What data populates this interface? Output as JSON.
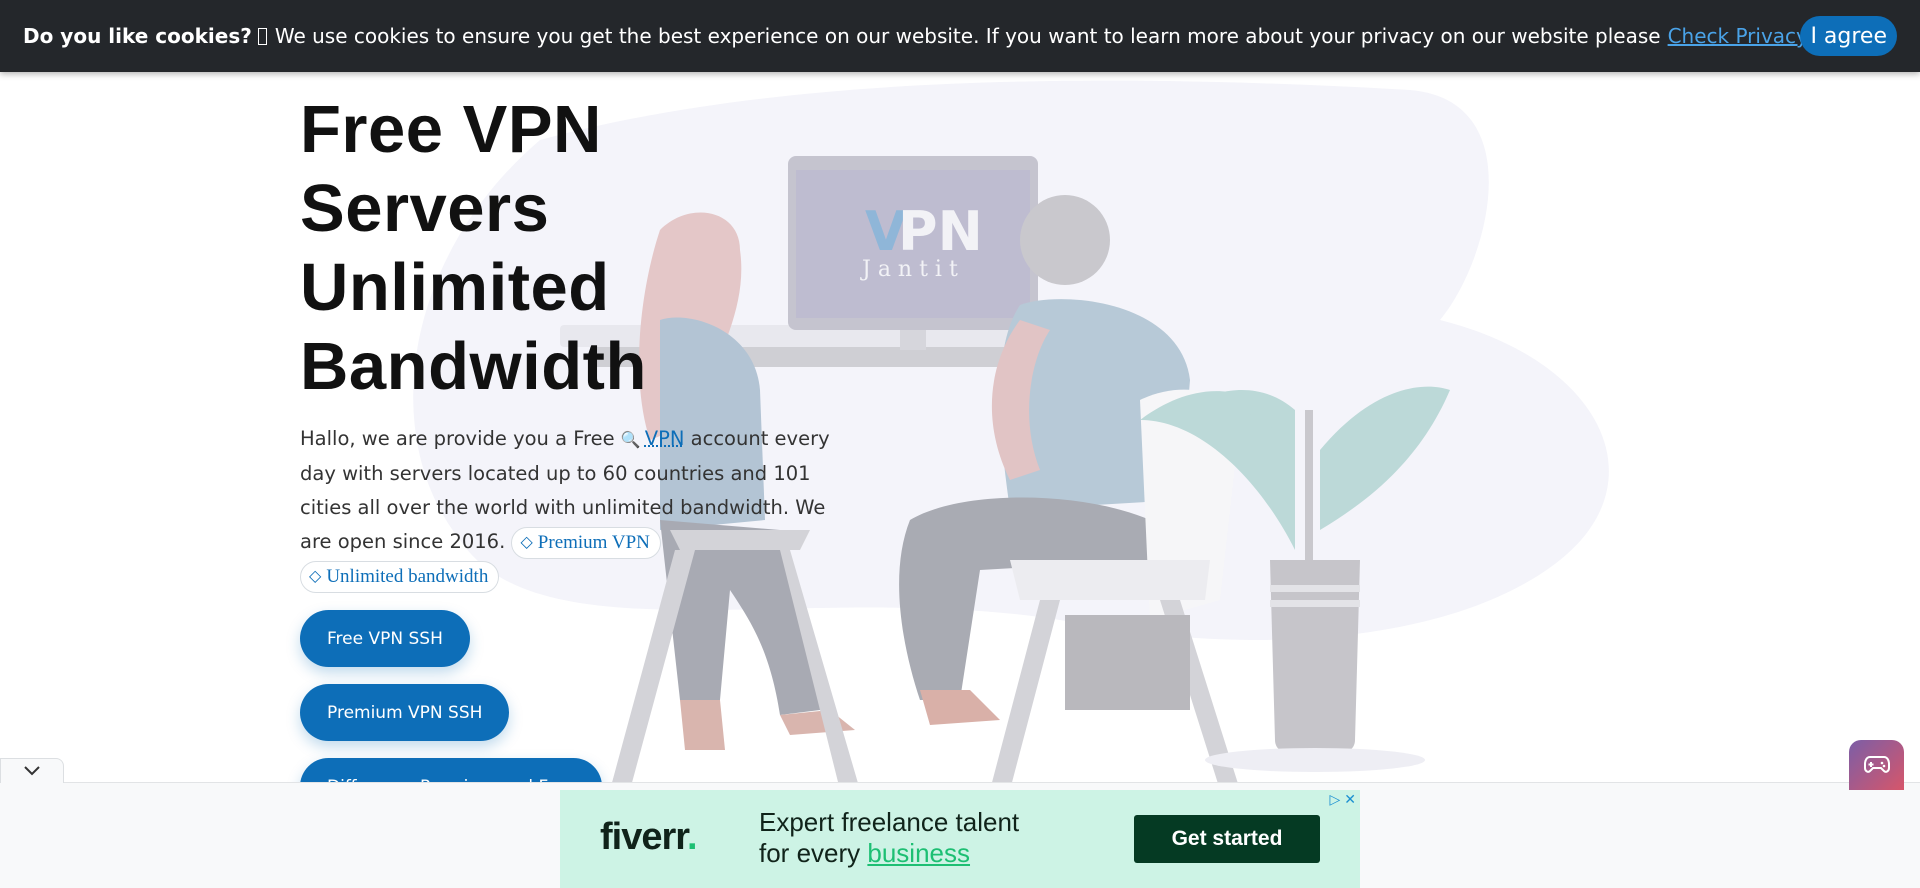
{
  "cookie": {
    "title": "Do you like cookies?",
    "glyph": "",
    "message": "We use cookies to ensure you get the best experience on our website. If you want to learn more about your privacy on our website please",
    "policy_link": "Check Privacy Policy",
    "agree_label": "I agree"
  },
  "hero": {
    "title_lines": [
      "Free VPN",
      "Servers",
      "Unlimited",
      "Bandwidth"
    ],
    "desc_before": "Hallo, we are provide you a Free",
    "desc_link": "VPN",
    "desc_after": "account every day with servers located up to 60 countries and 101 cities all over the world with unlimited bandwidth. We are open since 2016.",
    "tags": [
      "Premium VPN",
      "Unlimited bandwidth"
    ],
    "buttons": [
      "Free VPN SSH",
      "Premium VPN SSH",
      "Difference Premium and Free"
    ]
  },
  "illustration": {
    "logo_v": "V",
    "logo_pn": "PN",
    "logo_sub": "J a n t i t"
  },
  "ad": {
    "brand": "fiverr",
    "brand_dot": ".",
    "headline_line1": "Expert freelance talent",
    "headline_line2_prefix": "for every",
    "headline_highlight": "business",
    "cta": "Get started"
  },
  "colors": {
    "primary": "#0d6eb8",
    "cookie_bg": "#24272b",
    "ad_bg": "#cdf3e5",
    "ad_cta_bg": "#053a23"
  },
  "icons": {
    "search": "magnifier-icon",
    "tag": "tag-icon",
    "collapse": "chevron-down-icon",
    "game": "gamepad-icon",
    "ad_choices": "adchoices-icon",
    "close": "close-icon"
  }
}
